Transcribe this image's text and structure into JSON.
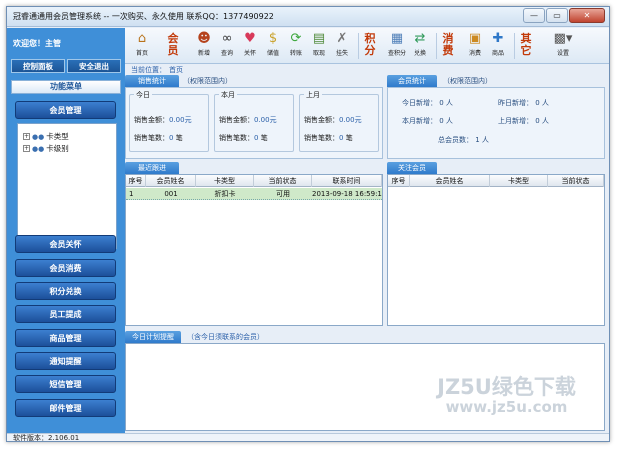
{
  "window": {
    "title": "冠睿通通用会员管理系统 -- 一次购买、永久使用 联系QQ：1377490922",
    "minimize": "—",
    "maximize": "▭",
    "close": "✕"
  },
  "sidebar": {
    "welcome": "欢迎您！主管",
    "control_panel": "控制面板",
    "safe_exit": "安全退出",
    "function_menu": "功能菜单",
    "member_mgmt": "会员管理",
    "tree": [
      {
        "label": "卡类型"
      },
      {
        "label": "卡级别"
      }
    ],
    "menus": [
      "会员关怀",
      "会员消费",
      "积分兑换",
      "员工提成",
      "商品管理",
      "通知提醒",
      "短信管理",
      "邮件管理"
    ]
  },
  "toolbar": {
    "home": "首页",
    "member_big": "会员",
    "add": "新增",
    "query": "查询",
    "care": "关怀",
    "recharge": "储值",
    "convert": "转账",
    "withdraw": "取现",
    "report_loss": "挂失",
    "points_big": "积分",
    "query_points": "查积分",
    "redeem": "兑换",
    "consume_big": "消费",
    "consume": "消费",
    "goods": "商品",
    "other_big": "其它",
    "settings": "设置"
  },
  "location": {
    "label": "当前位置：",
    "value": "首页"
  },
  "sales_stats": {
    "tab": "销售统计",
    "note": "（权限范围内）",
    "groups": [
      {
        "title": "今日",
        "amount_label": "销售金额：",
        "amount": "0.00元",
        "count_label": "销售笔数：",
        "count": "0",
        "unit": "笔"
      },
      {
        "title": "本月",
        "amount_label": "销售金额：",
        "amount": "0.00元",
        "count_label": "销售笔数：",
        "count": "0",
        "unit": "笔"
      },
      {
        "title": "上月",
        "amount_label": "销售金额：",
        "amount": "0.00元",
        "count_label": "销售笔数：",
        "count": "0",
        "unit": "笔"
      }
    ]
  },
  "member_stats": {
    "tab": "会员统计",
    "note": "（权限范围内）",
    "today_new": "今日新增：",
    "today_val": "0  人",
    "yesterday_new": "昨日新增：",
    "yesterday_val": "0  人",
    "month_new": "本月新增：",
    "month_val": "0  人",
    "last_month_new": "上月新增：",
    "last_month_val": "0  人",
    "total": "总会员数：",
    "total_val": "1  人"
  },
  "recent": {
    "tab": "最近跟进",
    "headers": [
      "序号",
      "会员姓名",
      "卡类型",
      "当前状态",
      "联系时间"
    ],
    "rows": [
      [
        "1",
        "001",
        "折扣卡",
        "可用",
        "2013-09-18 16:59:19"
      ]
    ]
  },
  "followed": {
    "tab": "关注会员",
    "headers": [
      "序号",
      "会员姓名",
      "卡类型",
      "当前状态"
    ]
  },
  "reminder": {
    "tab": "今日计划提醒",
    "note": "（含今日须联系的会员）"
  },
  "status": {
    "version": "软件版本：2.106.01"
  },
  "watermark": {
    "line1": "JZ5U绿色下载",
    "line2": "www.jz5u.com"
  },
  "colors": {
    "sidebar": "#3f8fd8",
    "menu_button": "#1c4f9a",
    "tab": "#2f7acb",
    "row_highlight": "#cfe9c9",
    "toolbar_text_big": "#c23a0a"
  }
}
